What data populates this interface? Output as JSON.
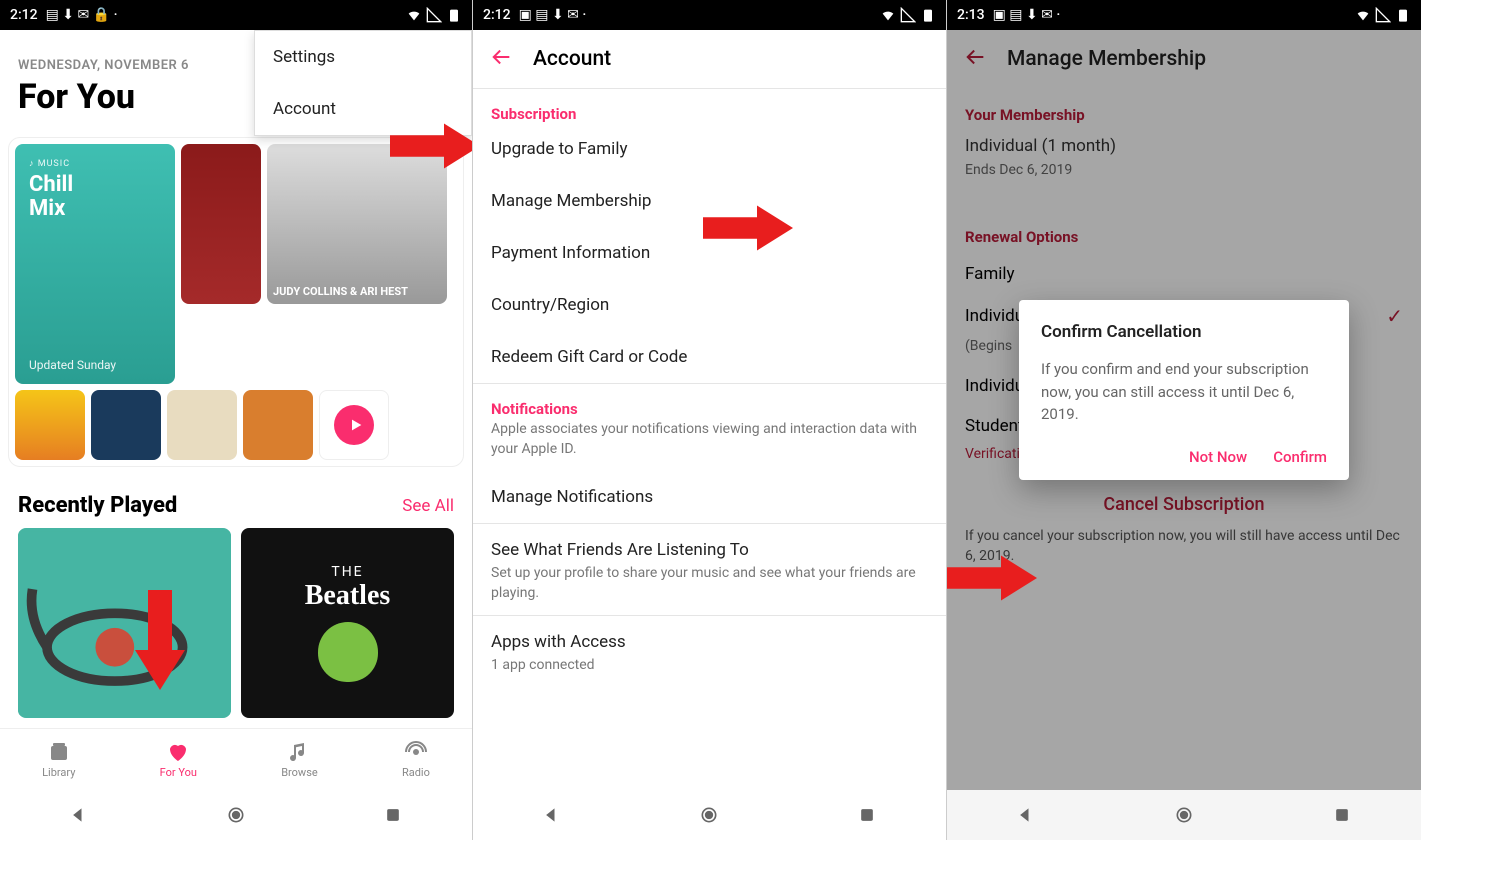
{
  "panel1": {
    "status": {
      "time": "2:12",
      "icons": "⎘ ⬇ ✉ 🔑 ·"
    },
    "date_label": "WEDNESDAY, NOVEMBER 6",
    "title": "For You",
    "menu": {
      "settings": "Settings",
      "account": "Account"
    },
    "chill": {
      "brand": "♪ MUSIC",
      "line1": "Chill",
      "line2": "Mix",
      "updated": "Updated Sunday"
    },
    "photo_label": "JUDY COLLINS & ARI HEST",
    "recent": {
      "heading": "Recently Played",
      "see_all": "See All"
    },
    "album2": {
      "the": "THE",
      "name": "Beatles"
    },
    "tabs": {
      "library": "Library",
      "for_you": "For You",
      "browse": "Browse",
      "radio": "Radio"
    }
  },
  "panel2": {
    "status": {
      "time": "2:12"
    },
    "title": "Account",
    "sections": {
      "subscription": "Subscription",
      "upgrade": "Upgrade to Family",
      "manage": "Manage Membership",
      "payment": "Payment Information",
      "country": "Country/Region",
      "redeem": "Redeem Gift Card or Code",
      "notifications": "Notifications",
      "notif_sub": "Apple associates your notifications viewing and interaction data with your Apple ID.",
      "manage_notif": "Manage Notifications",
      "friends": "See What Friends Are Listening To",
      "friends_sub": "Set up your profile to share your music and see what your friends are playing.",
      "apps": "Apps with Access",
      "apps_sub": "1 app connected"
    }
  },
  "panel3": {
    "status": {
      "time": "2:13"
    },
    "title": "Manage Membership",
    "your_membership": "Your Membership",
    "plan": "Individual (1 month)",
    "ends": "Ends Dec 6, 2019",
    "renewal": "Renewal Options",
    "opts": {
      "family": "Family",
      "individual": "Individual",
      "begins": "(Begins",
      "individual2": "Individual",
      "student": "Student",
      "verification": "Verification"
    },
    "cancel": "Cancel Subscription",
    "cancel_note": "If you cancel your subscription now, you will still have access until Dec 6, 2019.",
    "dialog": {
      "title": "Confirm Cancellation",
      "body": "If you confirm and end your subscription now, you can still access it until Dec 6, 2019.",
      "not_now": "Not Now",
      "confirm": "Confirm"
    }
  }
}
